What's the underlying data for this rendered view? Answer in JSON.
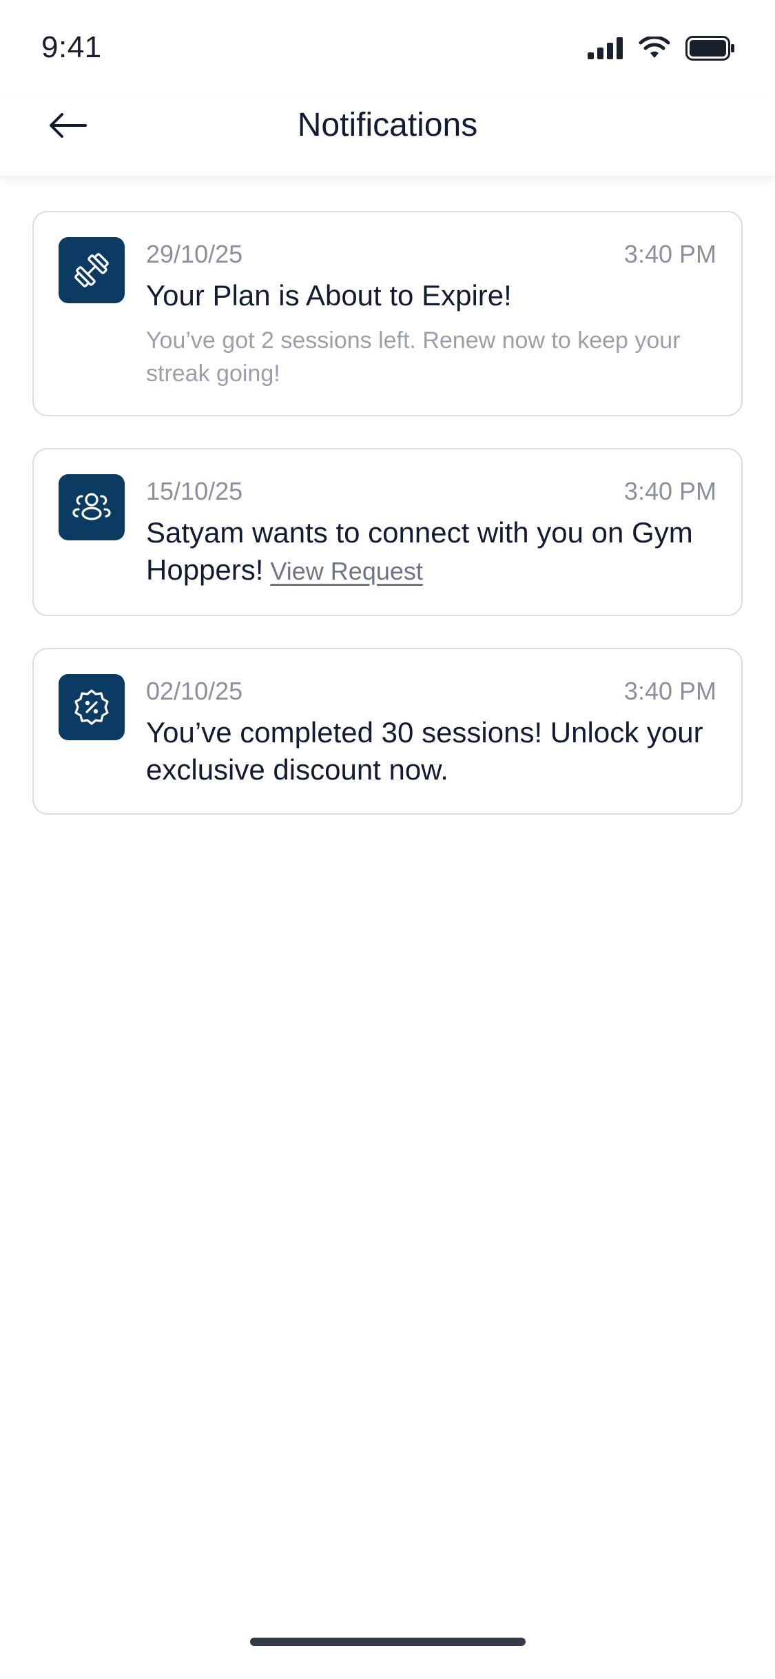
{
  "status_bar": {
    "time": "9:41"
  },
  "header": {
    "title": "Notifications",
    "back_icon": "arrow-left-icon"
  },
  "notifications": [
    {
      "icon": "dumbbell-icon",
      "date": "29/10/25",
      "time": "3:40 PM",
      "title": "Your Plan is About to Expire!",
      "body": "You’ve got 2 sessions left. Renew now to keep your streak going!"
    },
    {
      "icon": "users-icon",
      "date": "15/10/25",
      "time": "3:40 PM",
      "title": "Satyam wants to connect with you on Gym Hoppers!",
      "link": "View Request"
    },
    {
      "icon": "discount-badge-icon",
      "date": "02/10/25",
      "time": "3:40 PM",
      "title": "You’ve completed 30 sessions! Unlock your exclusive discount now."
    }
  ],
  "colors": {
    "icon_bg": "#0b3a63",
    "text_primary": "#131b33",
    "text_muted": "#8a909c",
    "card_border": "#d9dbe0"
  }
}
